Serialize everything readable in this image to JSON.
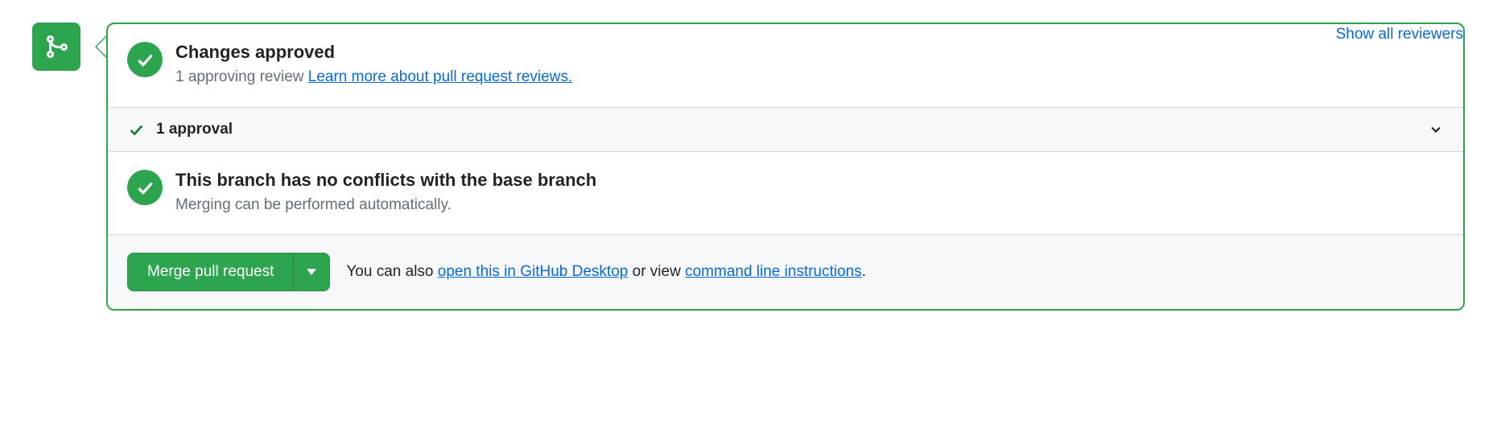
{
  "header": {
    "title": "Changes approved",
    "subtitle_prefix": "1 approving review ",
    "learn_more_label": "Learn more about pull request reviews.",
    "show_reviewers_label": "Show all reviewers"
  },
  "approval_row": {
    "label": "1 approval"
  },
  "conflicts": {
    "title": "This branch has no conflicts with the base branch",
    "subtitle": "Merging can be performed automatically."
  },
  "footer": {
    "merge_button_label": "Merge pull request",
    "alt_text_prefix": "You can also ",
    "desktop_link": "open this in GitHub Desktop",
    "alt_text_middle": " or view ",
    "cli_link": "command line instructions",
    "alt_text_suffix": "."
  }
}
